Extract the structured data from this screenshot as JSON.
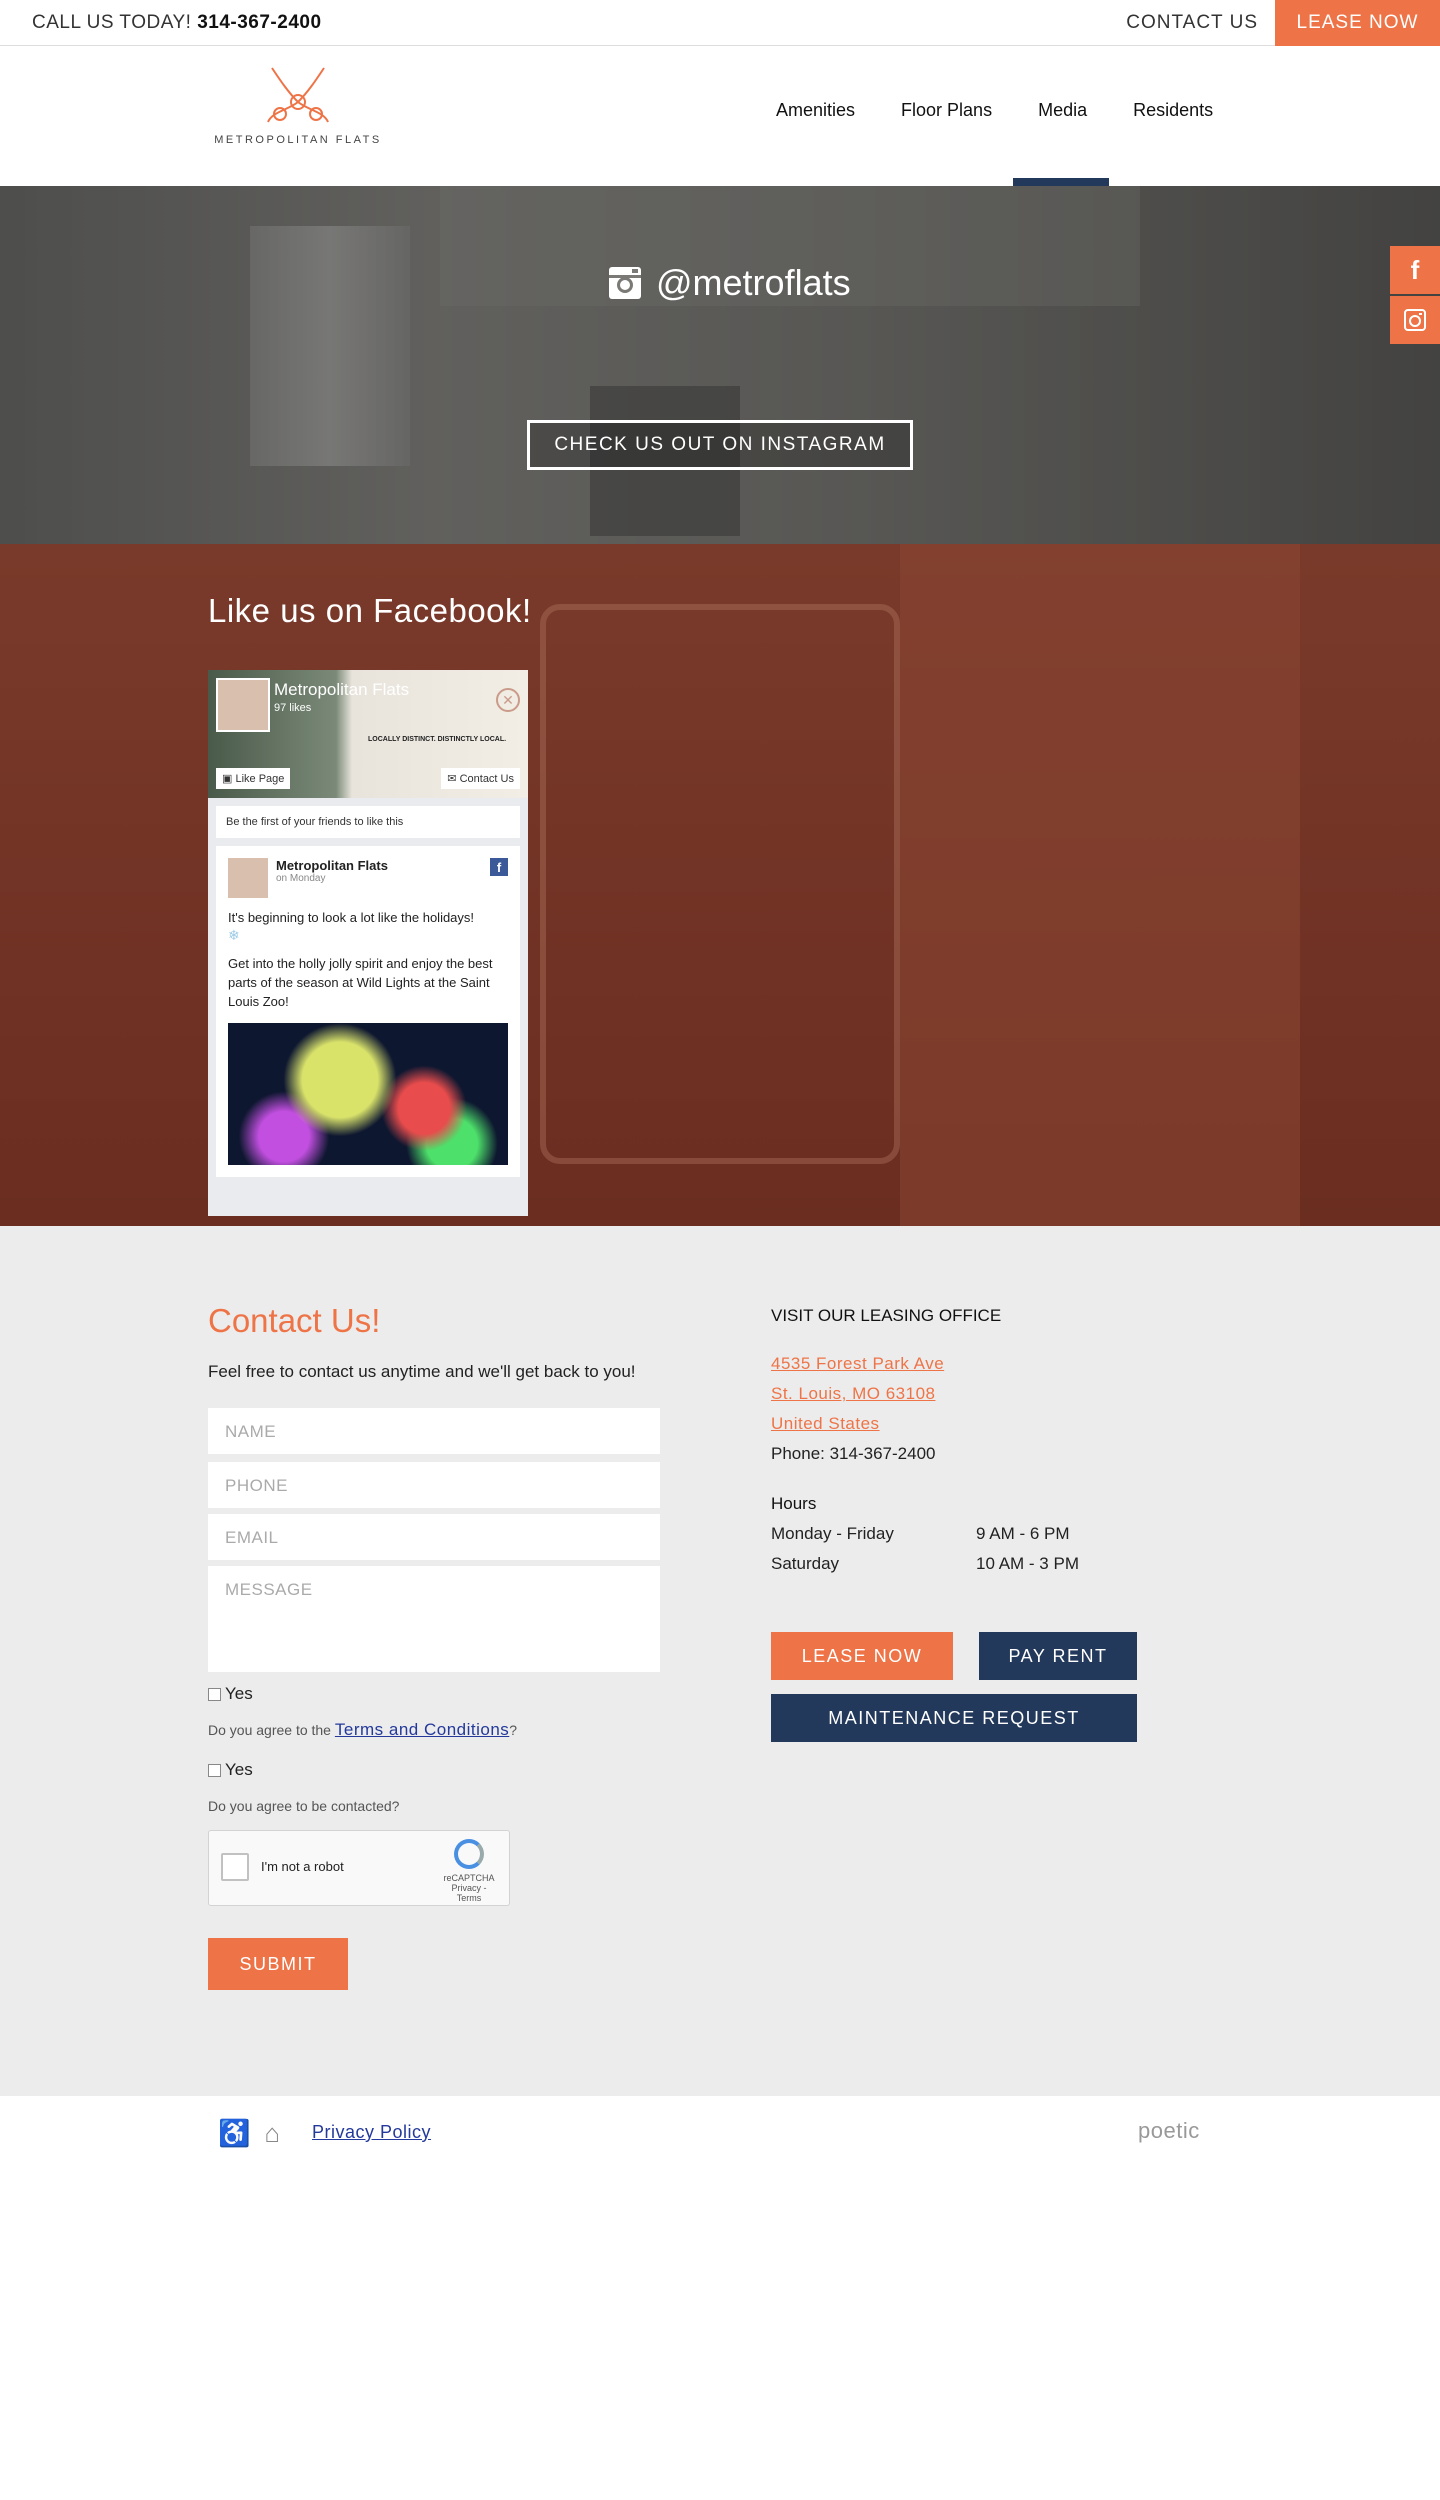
{
  "topbar": {
    "call_label": "CALL US TODAY!",
    "phone": "314-367-2400",
    "contact_label": "CONTACT US",
    "lease_label": "LEASE NOW"
  },
  "brand": {
    "name": "METROPOLITAN FLATS",
    "accent": "#ee7447",
    "navy": "#23395b"
  },
  "nav": {
    "items": [
      "Amenities",
      "Floor Plans",
      "Media",
      "Residents"
    ],
    "active": "Media"
  },
  "instagram": {
    "handle": "@metroflats",
    "cta": "CHECK US OUT ON INSTAGRAM"
  },
  "side_social": {
    "icons": [
      "facebook-icon",
      "instagram-icon"
    ],
    "facebook_glyph": "f"
  },
  "facebook": {
    "heading": "Like us on Facebook!",
    "page_name": "Metropolitan Flats",
    "likes": "97 likes",
    "like_page": "Like Page",
    "contact_us": "Contact Us",
    "cover_tagline": "LOCALLY DISTINCT. DISTINCTLY LOCAL.",
    "friends_text": "Be the first of your friends to like this",
    "post": {
      "author": "Metropolitan Flats",
      "when": "on Monday",
      "line1": "It's beginning to look a lot like the holidays!",
      "line2": "Get into the holly jolly spirit and enjoy the best parts of the season at Wild Lights at the Saint Louis Zoo!"
    }
  },
  "contact": {
    "heading": "Contact Us!",
    "intro": "Feel free to contact us anytime and we'll get back to you!",
    "placeholders": {
      "name": "NAME",
      "phone": "PHONE",
      "email": "EMAIL",
      "message": "MESSAGE"
    },
    "yes": "Yes",
    "terms_prefix": "Do you agree to the",
    "terms_link": "Terms and Conditions",
    "terms_suffix": "?",
    "contacted_question": "Do you agree to be contacted?",
    "captcha_label": "I'm not a robot",
    "captcha_brand": "reCAPTCHA",
    "captcha_sub": "Privacy - Terms",
    "submit": "SUBMIT"
  },
  "office": {
    "title": "VISIT OUR LEASING OFFICE",
    "address1": "4535 Forest Park Ave",
    "address2": "St. Louis, MO 63108",
    "country": "United States",
    "phone": "Phone: 314-367-2400",
    "hours_title": "Hours",
    "hours": [
      {
        "days": "Monday - Friday",
        "time": "9 AM - 6 PM"
      },
      {
        "days": "Saturday",
        "time": "10 AM - 3 PM"
      }
    ],
    "lease_now": "LEASE NOW",
    "pay_rent": "PAY RENT",
    "maintenance": "MAINTENANCE REQUEST"
  },
  "footer": {
    "privacy": "Privacy Policy",
    "vendor": "poetic"
  }
}
